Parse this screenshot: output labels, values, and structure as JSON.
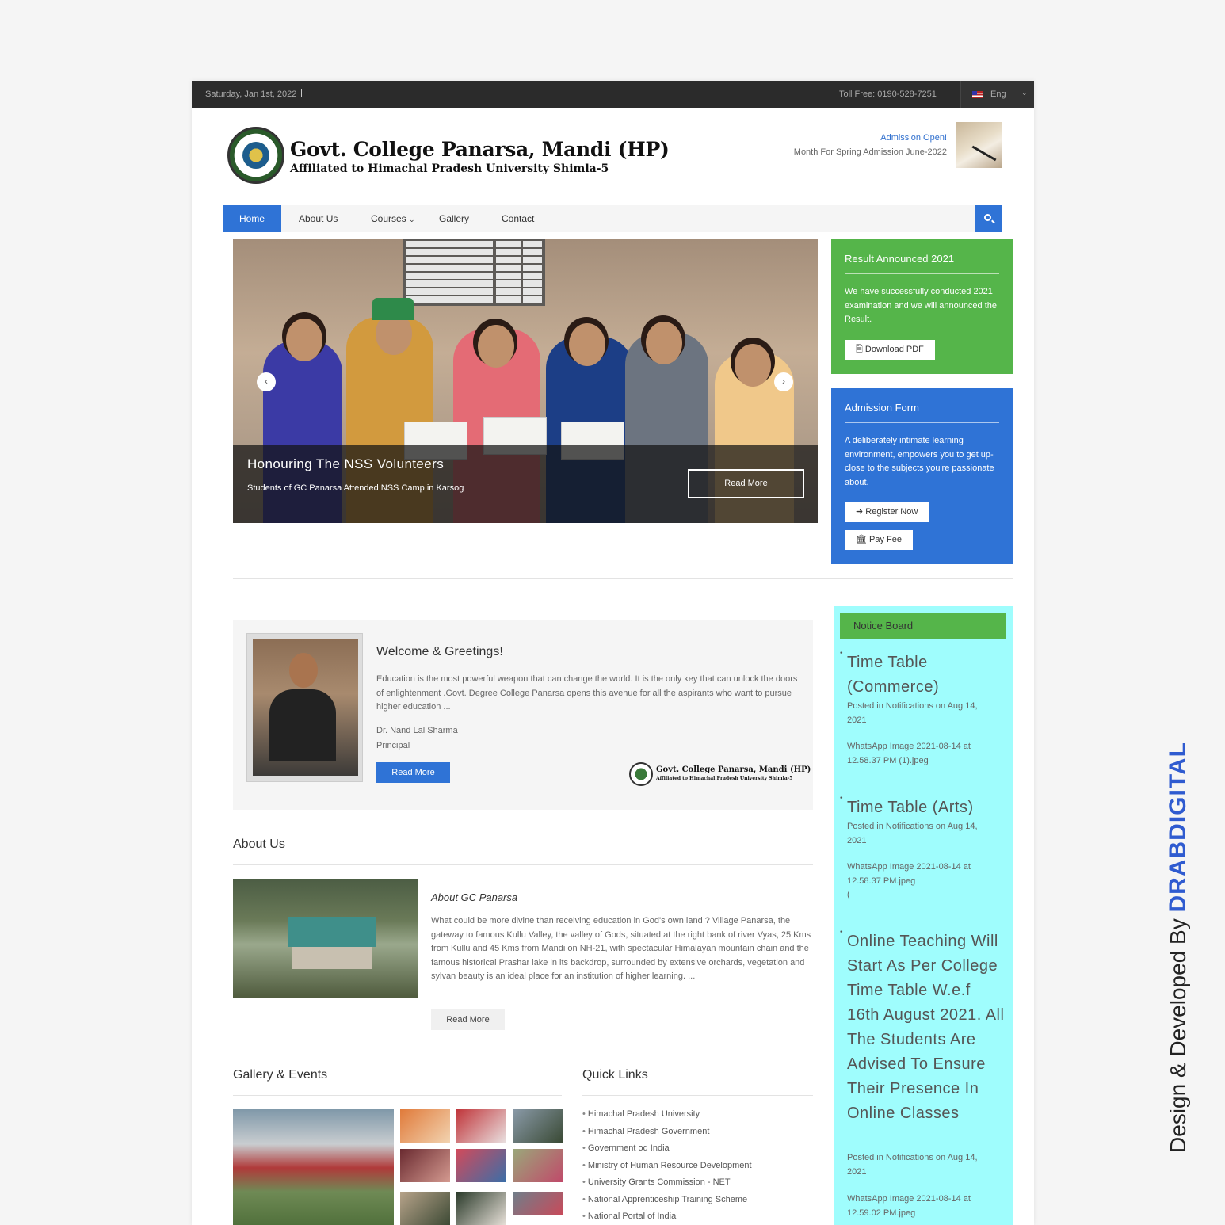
{
  "topbar": {
    "date": "Saturday, Jan 1st, 2022",
    "separator": "|",
    "toll_free": "Toll Free: 0190-528-7251",
    "language": "Eng"
  },
  "header": {
    "title": "Govt. College Panarsa, Mandi (HP)",
    "subtitle": "Affiliated to Himachal Pradesh University Shimla-5",
    "admission_open": "Admission Open!",
    "admission_month": "Month For Spring Admission June-2022"
  },
  "nav": {
    "items": [
      "Home",
      "About Us",
      "Courses",
      "Gallery",
      "Contact"
    ],
    "active": "Home"
  },
  "slider": {
    "title": "Honouring The NSS Volunteers",
    "subtitle": "Students of GC Panarsa Attended NSS Camp in Karsog",
    "button": "Read More"
  },
  "result_panel": {
    "title": "Result Announced 2021",
    "text": "We have successfully conducted 2021 examination and we will announced the Result.",
    "button": "Download PDF",
    "color": "#55b54a"
  },
  "admission_panel": {
    "title": "Admission Form",
    "text": "A deliberately intimate learning environment, empowers you to get up-close to the subjects you're passionate about.",
    "register": "Register Now",
    "pay": "Pay Fee",
    "color": "#2f73d6"
  },
  "welcome": {
    "title": "Welcome & Greetings!",
    "text": "Education is the most powerful weapon that can change the world. It is the only key that can unlock the doors of enlightenment .Govt. Degree College Panarsa opens this avenue for all the aspirants who want to pursue higher education ...",
    "name": "Dr. Nand Lal Sharma",
    "role": "Principal",
    "button": "Read More",
    "logo_title": "Govt. College Panarsa, Mandi (HP)",
    "logo_sub": "Affiliated to Himachal Pradesh University Shimla-5"
  },
  "about": {
    "heading": "About Us",
    "title": "About GC Panarsa",
    "text": "What could be more divine than receiving education in God's own land ? Village Panarsa, the gateway to famous Kullu Valley, the valley of Gods, situated at the right bank of river Vyas, 25 Kms from Kullu and 45 Kms from Mandi on NH-21, with spectacular Himalayan mountain chain and the famous historical Prashar lake in its backdrop, surrounded by extensive orchards, vegetation and sylvan beauty is an ideal place for an institution of higher learning. ...",
    "button": "Read More"
  },
  "gallery": {
    "heading": "Gallery & Events"
  },
  "quick_links": {
    "heading": "Quick Links",
    "items": [
      "Himachal Pradesh University",
      "Himachal Pradesh Government",
      "Government od India",
      "Ministry of Human Resource Development",
      "University Grants Commission - NET",
      "National Apprenticeship Training Scheme",
      "National Portal of India"
    ]
  },
  "notice_board": {
    "heading": "Notice Board",
    "color": "#9ffdfd",
    "items": [
      {
        "title": "Time Table (Commerce)",
        "meta": "Posted in Notifications on Aug 14, 2021",
        "file": "WhatsApp Image 2021-08-14 at 12.58.37 PM (1).jpeg"
      },
      {
        "title": "Time Table (Arts)",
        "meta": "Posted in Notifications on Aug 14, 2021",
        "file": "WhatsApp Image 2021-08-14 at 12.58.37 PM.jpeg",
        "extra": "("
      },
      {
        "title": "Online Teaching Will Start As Per College Time Table W.e.f 16th August 2021. All The Students Are Advised To Ensure Their Presence In Online Classes",
        "meta": "Posted in Notifications on Aug 14, 2021",
        "file": "WhatsApp Image 2021-08-14 at 12.59.02 PM.jpeg"
      }
    ]
  },
  "credit": {
    "prefix": "Design & Developed By ",
    "brand": "DRABDIGITAL"
  }
}
